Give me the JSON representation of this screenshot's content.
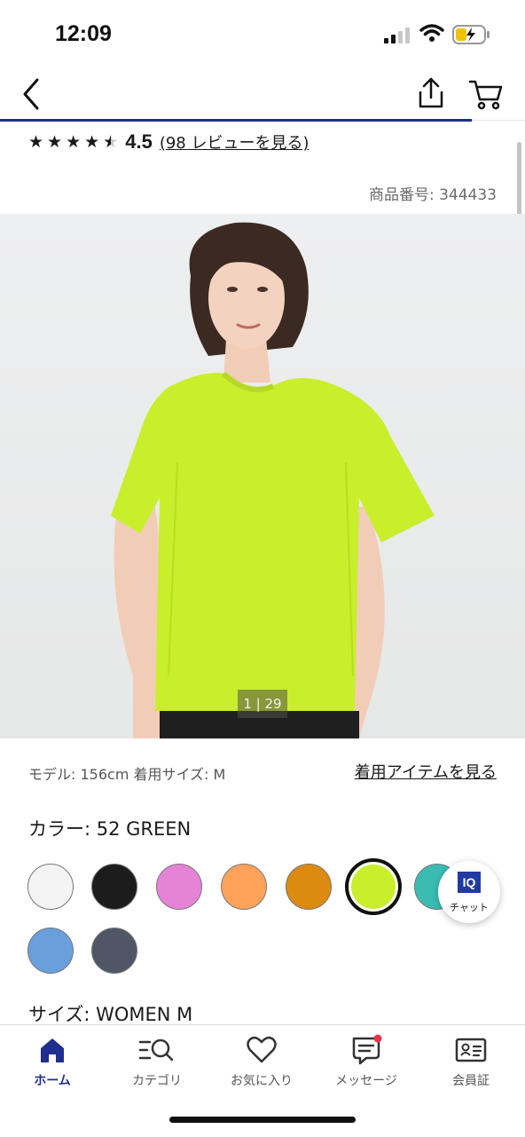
{
  "status_bar": {
    "time": "12:09"
  },
  "rating": {
    "value": "4.5",
    "review_link": "(98 レビューを見る)"
  },
  "product_number": "商品番号: 344433",
  "image_counter": "1 | 29",
  "model_info": "モデル: 156cm 着用サイズ: M",
  "worn_items_link": "着用アイテムを見る",
  "color": {
    "label": "カラー:  52 GREEN"
  },
  "swatches": [
    {
      "name": "white",
      "hex": "#f4f4f4"
    },
    {
      "name": "black",
      "hex": "#1c1c1c"
    },
    {
      "name": "pink",
      "hex": "#e584d6"
    },
    {
      "name": "orange",
      "hex": "#ffa25a"
    },
    {
      "name": "dark-orange",
      "hex": "#dc8a10"
    },
    {
      "name": "green",
      "hex": "#c9ee2c",
      "selected": true
    },
    {
      "name": "teal",
      "hex": "#3bbcb3"
    },
    {
      "name": "blue",
      "hex": "#6a9fdc"
    },
    {
      "name": "gray",
      "hex": "#4f5766"
    }
  ],
  "size": {
    "label": "サイズ:  WOMEN M"
  },
  "chat": {
    "badge": "IQ",
    "label": "チャット"
  },
  "nav": {
    "items": [
      {
        "label": "ホーム",
        "icon": "home-icon",
        "active": true
      },
      {
        "label": "カテゴリ",
        "icon": "category-search-icon"
      },
      {
        "label": "お気に入り",
        "icon": "heart-icon"
      },
      {
        "label": "メッセージ",
        "icon": "message-icon"
      },
      {
        "label": "会員証",
        "icon": "member-card-icon"
      }
    ]
  },
  "colors": {
    "accent": "#1f2f8f",
    "notification": "#e8334a"
  }
}
